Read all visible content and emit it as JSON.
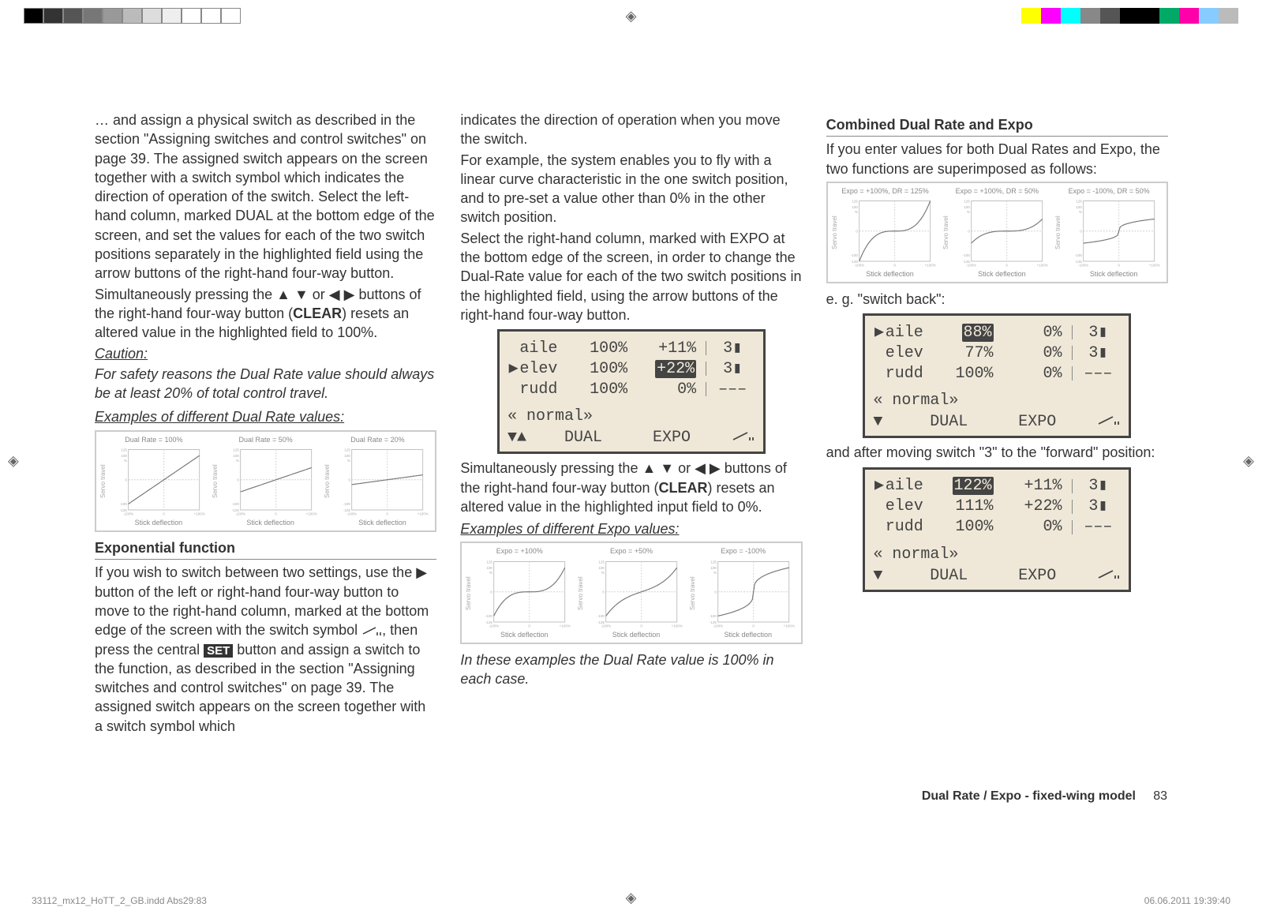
{
  "colorbars": {
    "left": [
      "#000",
      "#333",
      "#555",
      "#777",
      "#999",
      "#bbb",
      "#ddd",
      "#eee",
      "#fff",
      "#fff",
      "#fff"
    ],
    "right": [
      "#ff0",
      "#f0f",
      "#0ff",
      "#888",
      "#555",
      "#000",
      "#000",
      "#0a6",
      "#f0a",
      "#8cf",
      "#bbb"
    ]
  },
  "col1": {
    "p1": "… and assign a physical switch as described in the section \"Assigning switches and control switches\" on page 39. The assigned switch appears on the screen together with a switch symbol which indicates the direction of operation of the switch. Select the left-hand column, marked DUAL at the bottom edge of the screen, and set the values for each of the two switch positions separately in the highlighted field using the arrow buttons of the right-hand four-way button.",
    "p2a": "Simultaneously pressing the ▲ ▼ or ◀ ▶ buttons of the right-hand four-way button (",
    "p2b": "CLEAR",
    "p2c": ") resets an altered value in the highlighted field to 100%.",
    "caution": "Caution:",
    "caution_body": "For safety reasons the Dual Rate value should always be at least 20% of total control travel.",
    "examples_heading": "Examples of different Dual Rate values:",
    "exp_heading": "Exponential function",
    "exp_p_a": "If you wish to switch between two settings, use the ▶ button of the left or right-hand four-way button to move to the right-hand column, marked at the bottom edge of the screen with the switch symbol ",
    "exp_p_b": ", then press the central ",
    "set": "SET",
    "exp_p_c": " button and assign a switch to the function, as described in the section \"Assigning switches and control switches\" on page 39. The assigned switch appears on the screen together with a switch symbol which"
  },
  "col2": {
    "p1": "indicates the direction of operation when you move the switch.",
    "p2": "For example, the system enables you to fly with a linear curve characteristic in the one switch position, and to pre-set a value other than 0% in the other switch position.",
    "p3": "Select the right-hand column, marked with EXPO at the bottom edge of the screen, in order to change the Dual-Rate value for each of the two switch positions in the highlighted field, using the arrow buttons of the right-hand four-way button.",
    "p4a": "Simultaneously pressing the ▲ ▼ or ◀ ▶ buttons of the right-hand four-way button (",
    "p4b": "CLEAR",
    "p4c": ") resets an altered value in the highlighted input field to 0%.",
    "examples_heading": "Examples of different Expo values:",
    "caption": "In these examples the Dual Rate value is 100% in each case."
  },
  "col3": {
    "heading": "Combined Dual Rate and Expo",
    "p1": "If you enter values for both Dual Rates and Expo, the two functions are superimposed as follows:",
    "eg": "e. g. \"switch back\":",
    "p_after": "and after moving switch \"3\" to the \"forward\" position:"
  },
  "lcd1": {
    "rows": [
      {
        "label": "aile",
        "dual": "100%",
        "expo": "+11%",
        "sw": "3▮",
        "sel": false,
        "hl_expo": false
      },
      {
        "label": "elev",
        "dual": "100%",
        "expo": "+22%",
        "sw": "3▮",
        "sel": true,
        "hl_expo": true
      },
      {
        "label": "rudd",
        "dual": "100%",
        "expo": "0%",
        "sw": "–––",
        "sel": false,
        "hl_expo": false
      }
    ],
    "phase": "« normal»",
    "dual": "DUAL",
    "expo": "EXPO",
    "arrows": "▼▲"
  },
  "lcd2": {
    "rows": [
      {
        "label": "aile",
        "dual": "88%",
        "expo": "0%",
        "sw": "3▮",
        "sel": true,
        "hl_dual": true
      },
      {
        "label": "elev",
        "dual": "77%",
        "expo": "0%",
        "sw": "3▮",
        "sel": false
      },
      {
        "label": "rudd",
        "dual": "100%",
        "expo": "0%",
        "sw": "–––",
        "sel": false
      }
    ],
    "phase": "« normal»",
    "dual": "DUAL",
    "expo": "EXPO",
    "arrows": "▼"
  },
  "lcd3": {
    "rows": [
      {
        "label": "aile",
        "dual": "122%",
        "expo": "+11%",
        "sw": "3▮",
        "sel": true,
        "hl_dual": true
      },
      {
        "label": "elev",
        "dual": "111%",
        "expo": "+22%",
        "sw": "3▮",
        "sel": false
      },
      {
        "label": "rudd",
        "dual": "100%",
        "expo": "0%",
        "sw": "–––",
        "sel": false
      }
    ],
    "phase": "« normal»",
    "dual": "DUAL",
    "expo": "EXPO",
    "arrows": "▼"
  },
  "chart_data": [
    {
      "type": "line",
      "title": "Dual Rate = 100%",
      "xlabel": "Stick deflection",
      "ylabel": "Servo travel",
      "x": [
        -100,
        100
      ],
      "y": [
        -100,
        100
      ],
      "xlim": [
        -100,
        100
      ],
      "ylim": [
        -125,
        125
      ]
    },
    {
      "type": "line",
      "title": "Dual Rate = 50%",
      "xlabel": "Stick deflection",
      "ylabel": "Servo travel",
      "x": [
        -100,
        100
      ],
      "y": [
        -50,
        50
      ],
      "xlim": [
        -100,
        100
      ],
      "ylim": [
        -125,
        125
      ]
    },
    {
      "type": "line",
      "title": "Dual Rate = 20%",
      "xlabel": "Stick deflection",
      "ylabel": "Servo travel",
      "x": [
        -100,
        100
      ],
      "y": [
        -20,
        20
      ],
      "xlim": [
        -100,
        100
      ],
      "ylim": [
        -125,
        125
      ]
    },
    {
      "type": "line",
      "title": "Expo = +100%",
      "xlabel": "Stick deflection",
      "ylabel": "Servo travel",
      "curve": "expo",
      "k": 1.0,
      "xlim": [
        -100,
        100
      ],
      "ylim": [
        -125,
        125
      ]
    },
    {
      "type": "line",
      "title": "Expo = +50%",
      "xlabel": "Stick deflection",
      "ylabel": "Servo travel",
      "curve": "expo",
      "k": 0.5,
      "xlim": [
        -100,
        100
      ],
      "ylim": [
        -125,
        125
      ]
    },
    {
      "type": "line",
      "title": "Expo = -100%",
      "xlabel": "Stick deflection",
      "ylabel": "Servo travel",
      "curve": "expo",
      "k": -1.0,
      "xlim": [
        -100,
        100
      ],
      "ylim": [
        -125,
        125
      ]
    },
    {
      "type": "line",
      "title": "Expo = +100%, DR = 125%",
      "xlabel": "Stick deflection",
      "ylabel": "Servo travel",
      "curve": "expo",
      "k": 1.0,
      "dr": 1.25,
      "xlim": [
        -100,
        100
      ],
      "ylim": [
        -125,
        125
      ]
    },
    {
      "type": "line",
      "title": "Expo = +100%, DR = 50%",
      "xlabel": "Stick deflection",
      "ylabel": "Servo travel",
      "curve": "expo",
      "k": 1.0,
      "dr": 0.5,
      "xlim": [
        -100,
        100
      ],
      "ylim": [
        -125,
        125
      ]
    },
    {
      "type": "line",
      "title": "Expo = -100%, DR = 50%",
      "xlabel": "Stick deflection",
      "ylabel": "Servo travel",
      "curve": "expo",
      "k": -1.0,
      "dr": 0.5,
      "xlim": [
        -100,
        100
      ],
      "ylim": [
        -125,
        125
      ]
    }
  ],
  "yticks": [
    "125",
    "100",
    "%",
    "0",
    "-100",
    "-125"
  ],
  "xticks": [
    "-100%",
    "0",
    "+100%"
  ],
  "footer": {
    "title": "Dual Rate / Expo - fixed-wing model",
    "page": "83"
  },
  "printer": {
    "file": "33112_mx12_HoTT_2_GB.indd   Abs29:83",
    "date": "06.06.2011   19:39:40"
  }
}
